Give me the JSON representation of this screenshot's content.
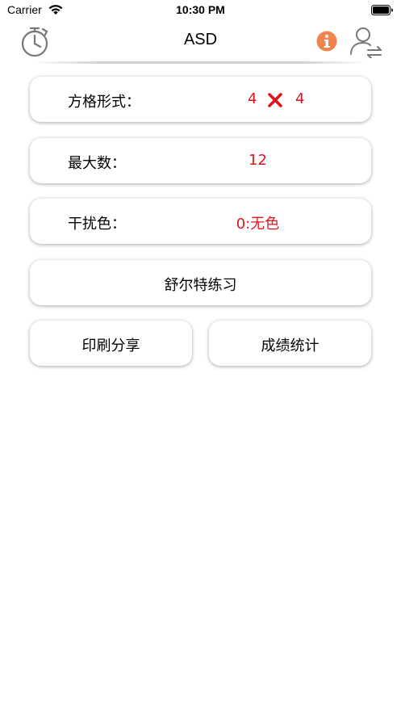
{
  "status_bar": {
    "carrier": "Carrier",
    "time": "10:30 PM"
  },
  "nav": {
    "title": "ASD",
    "info_color": "#f0834f"
  },
  "settings": {
    "grid": {
      "label": "方格形式：",
      "rows": "4",
      "cols": "4"
    },
    "max_number": {
      "label": "最大数：",
      "value": "12"
    },
    "distractor_color": {
      "label": "干扰色：",
      "value": "0:无色"
    }
  },
  "buttons": {
    "practice": "舒尔特练习",
    "print_share": "印刷分享",
    "statistics": "成绩统计"
  },
  "colors": {
    "value_red": "#e3131d",
    "icon_gray": "#777777"
  }
}
